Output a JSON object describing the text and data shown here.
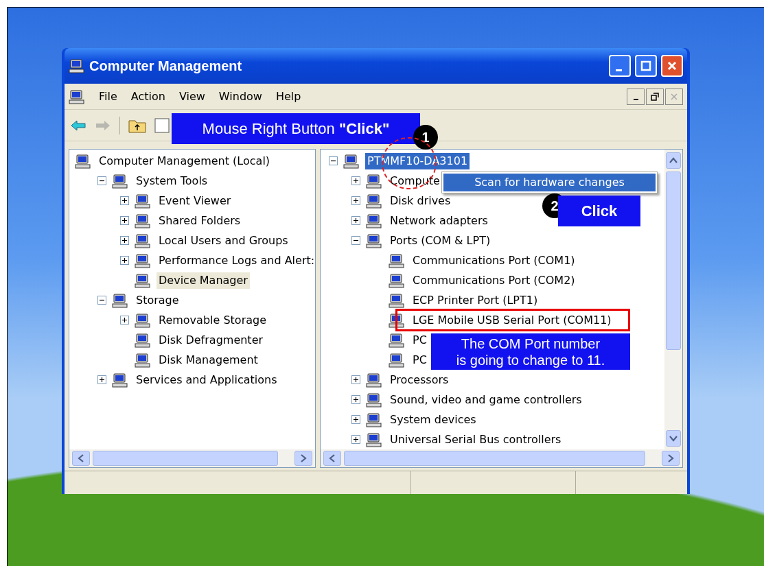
{
  "window": {
    "title": "Computer Management"
  },
  "menu": [
    {
      "label": "File"
    },
    {
      "label": "Action"
    },
    {
      "label": "View"
    },
    {
      "label": "Window"
    },
    {
      "label": "Help"
    }
  ],
  "left_tree": [
    {
      "label": "Computer Management (Local)",
      "selected": false,
      "children": [
        {
          "label": "System Tools",
          "expanded": true,
          "selected": false,
          "children": [
            {
              "label": "Event Viewer",
              "expanded": false,
              "selected": false
            },
            {
              "label": "Shared Folders",
              "expanded": false,
              "selected": false
            },
            {
              "label": "Local Users and Groups",
              "expanded": false,
              "selected": false
            },
            {
              "label": "Performance Logs and Alert:",
              "expanded": false,
              "selected": false
            },
            {
              "label": "Device Manager",
              "selected": true
            }
          ]
        },
        {
          "label": "Storage",
          "expanded": true,
          "selected": false,
          "children": [
            {
              "label": "Removable Storage",
              "expanded": false,
              "selected": false
            },
            {
              "label": "Disk Defragmenter",
              "selected": false
            },
            {
              "label": "Disk Management",
              "selected": false
            }
          ]
        },
        {
          "label": "Services and Applications",
          "expanded": false,
          "selected": false
        }
      ]
    }
  ],
  "right_tree": [
    {
      "label": "PTMMF10-DA3101",
      "expanded": true,
      "selected": true,
      "children": [
        {
          "label": "Compute",
          "expanded": false,
          "selected": false
        },
        {
          "label": "Disk drives",
          "expanded": false,
          "selected": false
        },
        {
          "label": "Network adapters",
          "expanded": false,
          "selected": false
        },
        {
          "label": "Ports (COM & LPT)",
          "expanded": true,
          "selected": false,
          "children": [
            {
              "label": "Communications Port (COM1)",
              "selected": false
            },
            {
              "label": "Communications Port (COM2)",
              "selected": false
            },
            {
              "label": "ECP Printer Port (LPT1)",
              "selected": false
            },
            {
              "label": "LGE Mobile USB Serial Port (COM11)",
              "selected": false
            },
            {
              "label": "PC",
              "selected": false
            },
            {
              "label": "PC",
              "selected": false
            }
          ]
        },
        {
          "label": "Processors",
          "expanded": false,
          "selected": false
        },
        {
          "label": "Sound, video and game controllers",
          "expanded": false,
          "selected": false
        },
        {
          "label": "System devices",
          "expanded": false,
          "selected": false
        },
        {
          "label": "Universal Serial Bus controllers",
          "expanded": false,
          "selected": false
        }
      ]
    }
  ],
  "annotations": [
    {
      "kind": "banner",
      "text": "Mouse Right Button **\"Click\"**"
    },
    {
      "kind": "step",
      "text": "1"
    },
    {
      "kind": "circle"
    },
    {
      "kind": "menu",
      "text": "Scan for hardware changes",
      "selected": true
    },
    {
      "kind": "step",
      "text": "2"
    },
    {
      "kind": "banner",
      "text": "**Click**"
    },
    {
      "kind": "highlight"
    },
    {
      "kind": "note",
      "text": "The COM Port number\nis going to change to 11."
    }
  ]
}
